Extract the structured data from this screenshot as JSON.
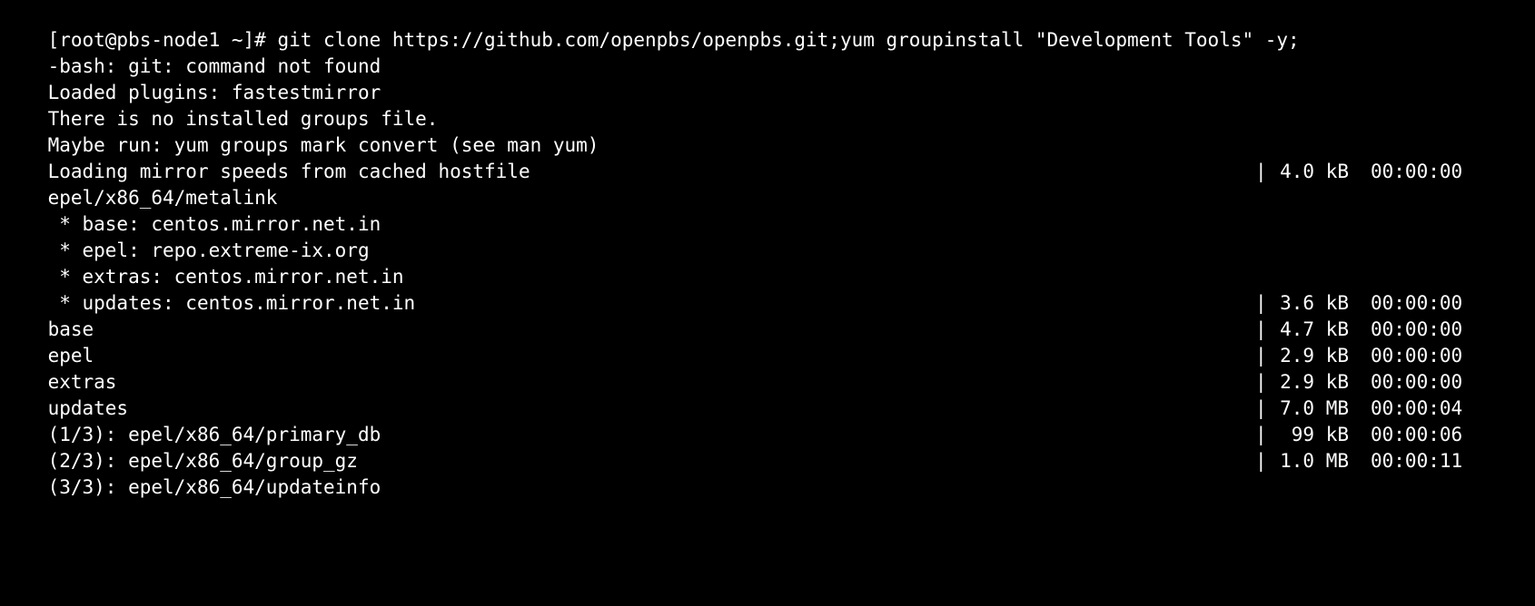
{
  "terminal": {
    "lines": [
      {
        "text": "[root@pbs-node1 ~]# git clone https://github.com/openpbs/openpbs.git;yum groupinstall \"Development Tools\" -y;"
      },
      {
        "text": "-bash: git: command not found"
      },
      {
        "text": "Loaded plugins: fastestmirror"
      },
      {
        "text": "There is no installed groups file."
      },
      {
        "text": "Maybe run: yum groups mark convert (see man yum)"
      },
      {
        "text": "Loading mirror speeds from cached hostfile"
      },
      {
        "text": "epel/x86_64/metalink",
        "sep": "|",
        "size": "4.0 kB",
        "time": "00:00:00"
      },
      {
        "text": " * base: centos.mirror.net.in"
      },
      {
        "text": " * epel: repo.extreme-ix.org"
      },
      {
        "text": " * extras: centos.mirror.net.in"
      },
      {
        "text": " * updates: centos.mirror.net.in"
      },
      {
        "text": "base",
        "sep": "|",
        "size": "3.6 kB",
        "time": "00:00:00"
      },
      {
        "text": "epel",
        "sep": "|",
        "size": "4.7 kB",
        "time": "00:00:00"
      },
      {
        "text": "extras",
        "sep": "|",
        "size": "2.9 kB",
        "time": "00:00:00"
      },
      {
        "text": "updates",
        "sep": "|",
        "size": "2.9 kB",
        "time": "00:00:00"
      },
      {
        "text": "(1/3): epel/x86_64/primary_db",
        "sep": "|",
        "size": "7.0 MB",
        "time": "00:00:04"
      },
      {
        "text": "(2/3): epel/x86_64/group_gz",
        "sep": "|",
        "size": "99 kB",
        "time": "00:00:06"
      },
      {
        "text": "(3/3): epel/x86_64/updateinfo",
        "sep": "|",
        "size": "1.0 MB",
        "time": "00:00:11"
      }
    ]
  },
  "colors": {
    "background": "#000000",
    "foreground": "#ffffff"
  }
}
